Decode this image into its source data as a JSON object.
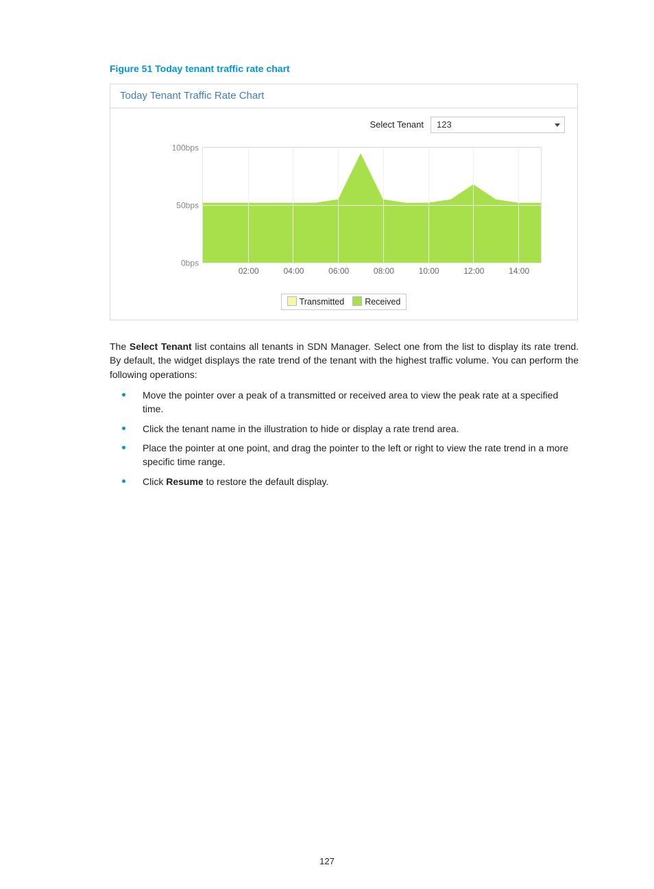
{
  "figure": {
    "caption": "Figure 51 Today tenant traffic rate chart",
    "widget_title": "Today Tenant Traffic Rate Chart",
    "tenant_label": "Select Tenant",
    "tenant_value": "123"
  },
  "chart_data": {
    "type": "area",
    "title": "Today Tenant Traffic Rate Chart",
    "xlabel": "",
    "ylabel": "",
    "ylim": [
      0,
      100
    ],
    "y_unit_suffix": "bps",
    "y_ticks": [
      0,
      50,
      100
    ],
    "y_tick_labels": [
      "0bps",
      "50bps",
      "100bps"
    ],
    "x": [
      "00:00",
      "01:00",
      "02:00",
      "03:00",
      "04:00",
      "05:00",
      "06:00",
      "07:00",
      "08:00",
      "09:00",
      "10:00",
      "11:00",
      "12:00",
      "13:00",
      "14:00",
      "15:00"
    ],
    "x_tick_labels": [
      "02:00",
      "04:00",
      "06:00",
      "08:00",
      "10:00",
      "12:00",
      "14:00"
    ],
    "series": [
      {
        "name": "Transmitted",
        "color": "#f6f7a8",
        "values": [
          50,
          50,
          50,
          50,
          50,
          50,
          50,
          50,
          50,
          50,
          50,
          50,
          50,
          50,
          50,
          50
        ]
      },
      {
        "name": "Received",
        "color": "#a7e04b",
        "values": [
          52,
          52,
          52,
          52,
          52,
          52,
          55,
          95,
          55,
          52,
          52,
          55,
          68,
          55,
          52,
          52
        ]
      }
    ],
    "legend": {
      "position": "bottom",
      "entries": [
        "Transmitted",
        "Received"
      ]
    }
  },
  "text": {
    "p1_pre": "The ",
    "p1_bold": "Select Tenant",
    "p1_post": " list contains all tenants in SDN Manager. Select one from the list to display its rate trend. By default, the widget displays the rate trend of the tenant with the highest traffic volume. You can perform the following operations:",
    "bullets": [
      "Move the pointer over a peak of a transmitted or received area to view the peak rate at a specified time.",
      "Click the tenant name in the illustration to hide or display a rate trend area.",
      "Place the pointer at one point, and drag the pointer to the left or right to view the rate trend in a more specific time range."
    ],
    "bullet4_pre": "Click ",
    "bullet4_bold": "Resume",
    "bullet4_post": " to restore the default display."
  },
  "page_number": "127"
}
